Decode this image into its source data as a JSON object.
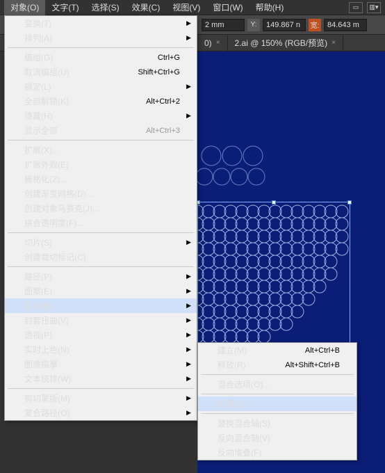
{
  "menubar": {
    "items": [
      "对象(O)",
      "文字(T)",
      "选择(S)",
      "效果(C)",
      "视图(V)",
      "窗口(W)",
      "帮助(H)"
    ]
  },
  "toolbar": {
    "val1": "2 mm",
    "y_label": "Y:",
    "y_val": "149.867 n",
    "w_label": "宽:",
    "w_val": "84.643 m"
  },
  "tabs": {
    "t1": "0)",
    "t2": "2.ai @ 150% (RGB/预览)"
  },
  "menu": {
    "transform": "变换(T)",
    "arrange": "排列(A)",
    "group": "编组(G)",
    "group_sc": "Ctrl+G",
    "ungroup": "取消编组(U)",
    "ungroup_sc": "Shift+Ctrl+G",
    "lock": "锁定(L)",
    "unlockall": "全部解锁(K)",
    "unlockall_sc": "Alt+Ctrl+2",
    "hide": "隐藏(H)",
    "showall": "显示全部",
    "showall_sc": "Alt+Ctrl+3",
    "expand": "扩展(X)...",
    "expandapp": "扩展外观(E)",
    "rasterize": "栅格化(Z)...",
    "gradmesh": "创建渐变网格(D)...",
    "mosaic": "创建对象马赛克(J)...",
    "flatten": "拼合透明度(F)...",
    "slice": "切片(S)",
    "trimmarks": "创建裁切标记(C)",
    "path": "路径(P)",
    "pattern": "图案(E)",
    "blend": "混合(B)",
    "envelope": "封套扭曲(V)",
    "perspective": "透视(P)",
    "livepaint": "实时上色(N)",
    "imagetrace": "图像描摹",
    "textwrap": "文本绕排(W)",
    "clipmask": "剪切蒙版(M)",
    "compound": "复合路径(O)"
  },
  "submenu": {
    "make": "建立(M)",
    "make_sc": "Alt+Ctrl+B",
    "release": "释放(R)",
    "release_sc": "Alt+Shift+Ctrl+B",
    "options": "混合选项(O)...",
    "expand": "扩展(E)",
    "replace": "替换混合轴(S)",
    "reverse": "反向混合轴(V)",
    "reversefb": "反向堆叠(F)"
  }
}
